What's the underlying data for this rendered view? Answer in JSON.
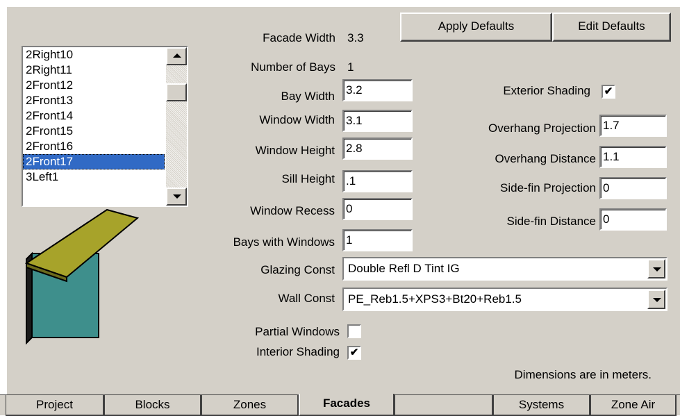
{
  "toolbar": {
    "apply_defaults": "Apply Defaults",
    "edit_defaults": "Edit Defaults"
  },
  "facade_list": {
    "items": [
      "2Right10",
      "2Right11",
      "2Front12",
      "2Front13",
      "2Front14",
      "2Front15",
      "2Front16",
      "2Front17",
      "3Left1"
    ],
    "selected": "2Front17"
  },
  "fields": {
    "facade_width": {
      "label": "Facade Width",
      "value": "3.3"
    },
    "number_of_bays": {
      "label": "Number of Bays",
      "value": "1"
    },
    "bay_width": {
      "label": "Bay Width",
      "value": "3.2"
    },
    "window_width": {
      "label": "Window Width",
      "value": "3.1"
    },
    "window_height": {
      "label": "Window Height",
      "value": "2.8"
    },
    "sill_height": {
      "label": "Sill Height",
      "value": ".1"
    },
    "window_recess": {
      "label": "Window Recess",
      "value": "0"
    },
    "bays_with_windows": {
      "label": "Bays with Windows",
      "value": "1"
    },
    "glazing_const": {
      "label": "Glazing Const",
      "value": "Double Refl D Tint IG"
    },
    "wall_const": {
      "label": "Wall Const",
      "value": "PE_Reb1.5+XPS3+Bt20+Reb1.5"
    },
    "partial_windows": {
      "label": "Partial Windows",
      "checked": false
    },
    "interior_shading": {
      "label": "Interior Shading",
      "checked": true
    }
  },
  "shading": {
    "exterior_shading": {
      "label": "Exterior Shading",
      "checked": true
    },
    "overhang_projection": {
      "label": "Overhang Projection",
      "value": "1.7"
    },
    "overhang_distance": {
      "label": "Overhang Distance",
      "value": "1.1"
    },
    "sidefin_projection": {
      "label": "Side-fin Projection",
      "value": "0"
    },
    "sidefin_distance": {
      "label": "Side-fin Distance",
      "value": "0"
    }
  },
  "note": "Dimensions are in meters.",
  "tabs": [
    "Project",
    "Blocks",
    "Zones",
    "Facades",
    "",
    "Systems",
    "Zone Air"
  ],
  "active_tab": "Facades",
  "check_mark": "✔",
  "colors": {
    "overhang": "#a7a32a",
    "wall": "#3e8f8c",
    "selection": "#316ac5"
  }
}
